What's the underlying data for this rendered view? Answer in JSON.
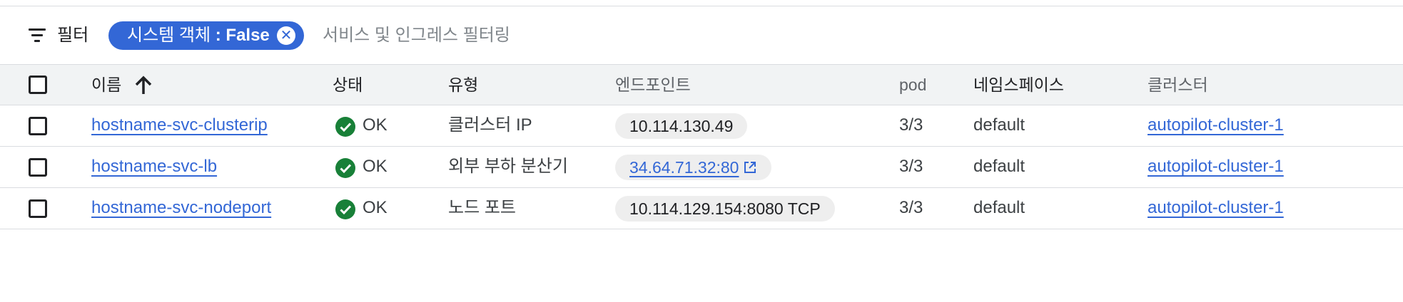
{
  "filter": {
    "label": "필터",
    "chip_key": "시스템 객체",
    "chip_value": ": False",
    "placeholder": "서비스 및 인그레스 필터링"
  },
  "table": {
    "columns": {
      "name": "이름",
      "status": "상태",
      "type": "유형",
      "endpoint": "엔드포인트",
      "pods": "pod",
      "namespace": "네임스페이스",
      "cluster": "클러스터"
    },
    "rows": [
      {
        "name": "hostname-svc-clusterip",
        "status": "OK",
        "type": "클러스터 IP",
        "endpoint": "10.114.130.49",
        "pods": "3/3",
        "namespace": "default",
        "cluster": "autopilot-cluster-1"
      },
      {
        "name": "hostname-svc-lb",
        "status": "OK",
        "type": "외부 부하 분산기",
        "endpoint": "34.64.71.32:80",
        "pods": "3/3",
        "namespace": "default",
        "cluster": "autopilot-cluster-1"
      },
      {
        "name": "hostname-svc-nodeport",
        "status": "OK",
        "type": "노드 포트",
        "endpoint": "10.114.129.154:8080 TCP",
        "pods": "3/3",
        "namespace": "default",
        "cluster": "autopilot-cluster-1"
      }
    ]
  },
  "colors": {
    "accent": "#3367d6",
    "ok_green": "#188038",
    "header_bg": "#f1f3f4",
    "pill_bg": "#eeeeee"
  },
  "icons": [
    "filter-icon",
    "close-icon",
    "sort-up-icon",
    "check-circle-icon",
    "external-link-icon"
  ]
}
